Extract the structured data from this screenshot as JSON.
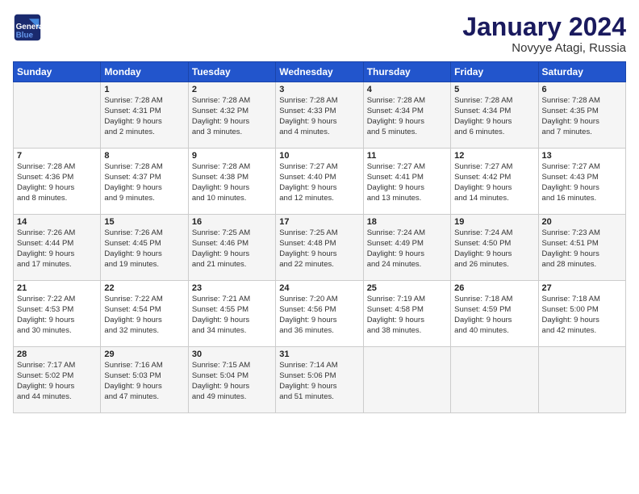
{
  "logo": {
    "line1": "General",
    "line2": "Blue"
  },
  "title": "January 2024",
  "location": "Novyye Atagi, Russia",
  "weekdays": [
    "Sunday",
    "Monday",
    "Tuesday",
    "Wednesday",
    "Thursday",
    "Friday",
    "Saturday"
  ],
  "weeks": [
    [
      {
        "day": "",
        "content": ""
      },
      {
        "day": "1",
        "content": "Sunrise: 7:28 AM\nSunset: 4:31 PM\nDaylight: 9 hours\nand 2 minutes."
      },
      {
        "day": "2",
        "content": "Sunrise: 7:28 AM\nSunset: 4:32 PM\nDaylight: 9 hours\nand 3 minutes."
      },
      {
        "day": "3",
        "content": "Sunrise: 7:28 AM\nSunset: 4:33 PM\nDaylight: 9 hours\nand 4 minutes."
      },
      {
        "day": "4",
        "content": "Sunrise: 7:28 AM\nSunset: 4:34 PM\nDaylight: 9 hours\nand 5 minutes."
      },
      {
        "day": "5",
        "content": "Sunrise: 7:28 AM\nSunset: 4:34 PM\nDaylight: 9 hours\nand 6 minutes."
      },
      {
        "day": "6",
        "content": "Sunrise: 7:28 AM\nSunset: 4:35 PM\nDaylight: 9 hours\nand 7 minutes."
      }
    ],
    [
      {
        "day": "7",
        "content": "Sunrise: 7:28 AM\nSunset: 4:36 PM\nDaylight: 9 hours\nand 8 minutes."
      },
      {
        "day": "8",
        "content": "Sunrise: 7:28 AM\nSunset: 4:37 PM\nDaylight: 9 hours\nand 9 minutes."
      },
      {
        "day": "9",
        "content": "Sunrise: 7:28 AM\nSunset: 4:38 PM\nDaylight: 9 hours\nand 10 minutes."
      },
      {
        "day": "10",
        "content": "Sunrise: 7:27 AM\nSunset: 4:40 PM\nDaylight: 9 hours\nand 12 minutes."
      },
      {
        "day": "11",
        "content": "Sunrise: 7:27 AM\nSunset: 4:41 PM\nDaylight: 9 hours\nand 13 minutes."
      },
      {
        "day": "12",
        "content": "Sunrise: 7:27 AM\nSunset: 4:42 PM\nDaylight: 9 hours\nand 14 minutes."
      },
      {
        "day": "13",
        "content": "Sunrise: 7:27 AM\nSunset: 4:43 PM\nDaylight: 9 hours\nand 16 minutes."
      }
    ],
    [
      {
        "day": "14",
        "content": "Sunrise: 7:26 AM\nSunset: 4:44 PM\nDaylight: 9 hours\nand 17 minutes."
      },
      {
        "day": "15",
        "content": "Sunrise: 7:26 AM\nSunset: 4:45 PM\nDaylight: 9 hours\nand 19 minutes."
      },
      {
        "day": "16",
        "content": "Sunrise: 7:25 AM\nSunset: 4:46 PM\nDaylight: 9 hours\nand 21 minutes."
      },
      {
        "day": "17",
        "content": "Sunrise: 7:25 AM\nSunset: 4:48 PM\nDaylight: 9 hours\nand 22 minutes."
      },
      {
        "day": "18",
        "content": "Sunrise: 7:24 AM\nSunset: 4:49 PM\nDaylight: 9 hours\nand 24 minutes."
      },
      {
        "day": "19",
        "content": "Sunrise: 7:24 AM\nSunset: 4:50 PM\nDaylight: 9 hours\nand 26 minutes."
      },
      {
        "day": "20",
        "content": "Sunrise: 7:23 AM\nSunset: 4:51 PM\nDaylight: 9 hours\nand 28 minutes."
      }
    ],
    [
      {
        "day": "21",
        "content": "Sunrise: 7:22 AM\nSunset: 4:53 PM\nDaylight: 9 hours\nand 30 minutes."
      },
      {
        "day": "22",
        "content": "Sunrise: 7:22 AM\nSunset: 4:54 PM\nDaylight: 9 hours\nand 32 minutes."
      },
      {
        "day": "23",
        "content": "Sunrise: 7:21 AM\nSunset: 4:55 PM\nDaylight: 9 hours\nand 34 minutes."
      },
      {
        "day": "24",
        "content": "Sunrise: 7:20 AM\nSunset: 4:56 PM\nDaylight: 9 hours\nand 36 minutes."
      },
      {
        "day": "25",
        "content": "Sunrise: 7:19 AM\nSunset: 4:58 PM\nDaylight: 9 hours\nand 38 minutes."
      },
      {
        "day": "26",
        "content": "Sunrise: 7:18 AM\nSunset: 4:59 PM\nDaylight: 9 hours\nand 40 minutes."
      },
      {
        "day": "27",
        "content": "Sunrise: 7:18 AM\nSunset: 5:00 PM\nDaylight: 9 hours\nand 42 minutes."
      }
    ],
    [
      {
        "day": "28",
        "content": "Sunrise: 7:17 AM\nSunset: 5:02 PM\nDaylight: 9 hours\nand 44 minutes."
      },
      {
        "day": "29",
        "content": "Sunrise: 7:16 AM\nSunset: 5:03 PM\nDaylight: 9 hours\nand 47 minutes."
      },
      {
        "day": "30",
        "content": "Sunrise: 7:15 AM\nSunset: 5:04 PM\nDaylight: 9 hours\nand 49 minutes."
      },
      {
        "day": "31",
        "content": "Sunrise: 7:14 AM\nSunset: 5:06 PM\nDaylight: 9 hours\nand 51 minutes."
      },
      {
        "day": "",
        "content": ""
      },
      {
        "day": "",
        "content": ""
      },
      {
        "day": "",
        "content": ""
      }
    ]
  ]
}
